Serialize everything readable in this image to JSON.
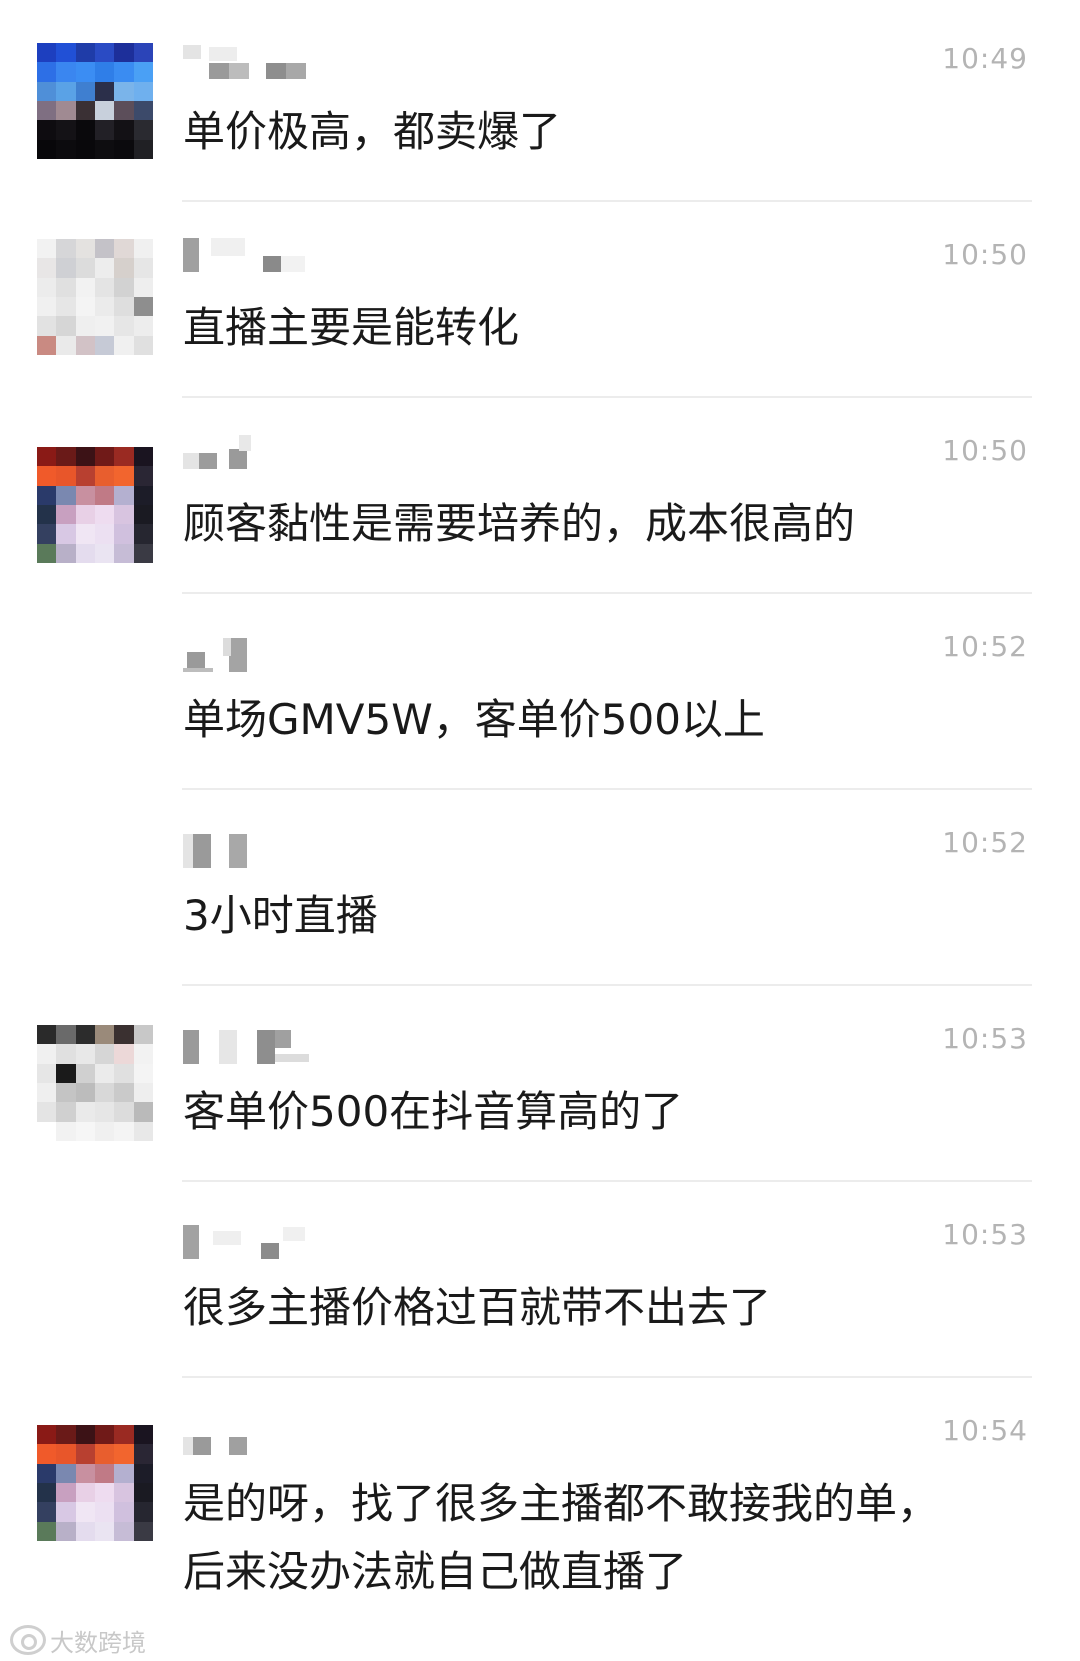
{
  "messages": [
    {
      "time": "10:49",
      "text": "单价极高，都卖爆了"
    },
    {
      "time": "10:50",
      "text": "直播主要是能转化"
    },
    {
      "time": "10:50",
      "text": "顾客黏性是需要培养的，成本很高的"
    },
    {
      "time": "10:52",
      "text": "单场GMV5W，客单价500以上"
    },
    {
      "time": "10:52",
      "text": "3小时直播"
    },
    {
      "time": "10:53",
      "text": "客单价500在抖音算高的了"
    },
    {
      "time": "10:53",
      "text": "很多主播价格过百就带不出去了"
    },
    {
      "time": "10:54",
      "text": "是的呀，找了很多主播都不敢接我的单，\n后来没办法就自己做直播了"
    }
  ],
  "watermark": {
    "text": "大数跨境"
  },
  "colors": {
    "time": "#b4b4b4",
    "text": "#1a1a1a",
    "divider": "#ececec",
    "background": "#ffffff"
  }
}
